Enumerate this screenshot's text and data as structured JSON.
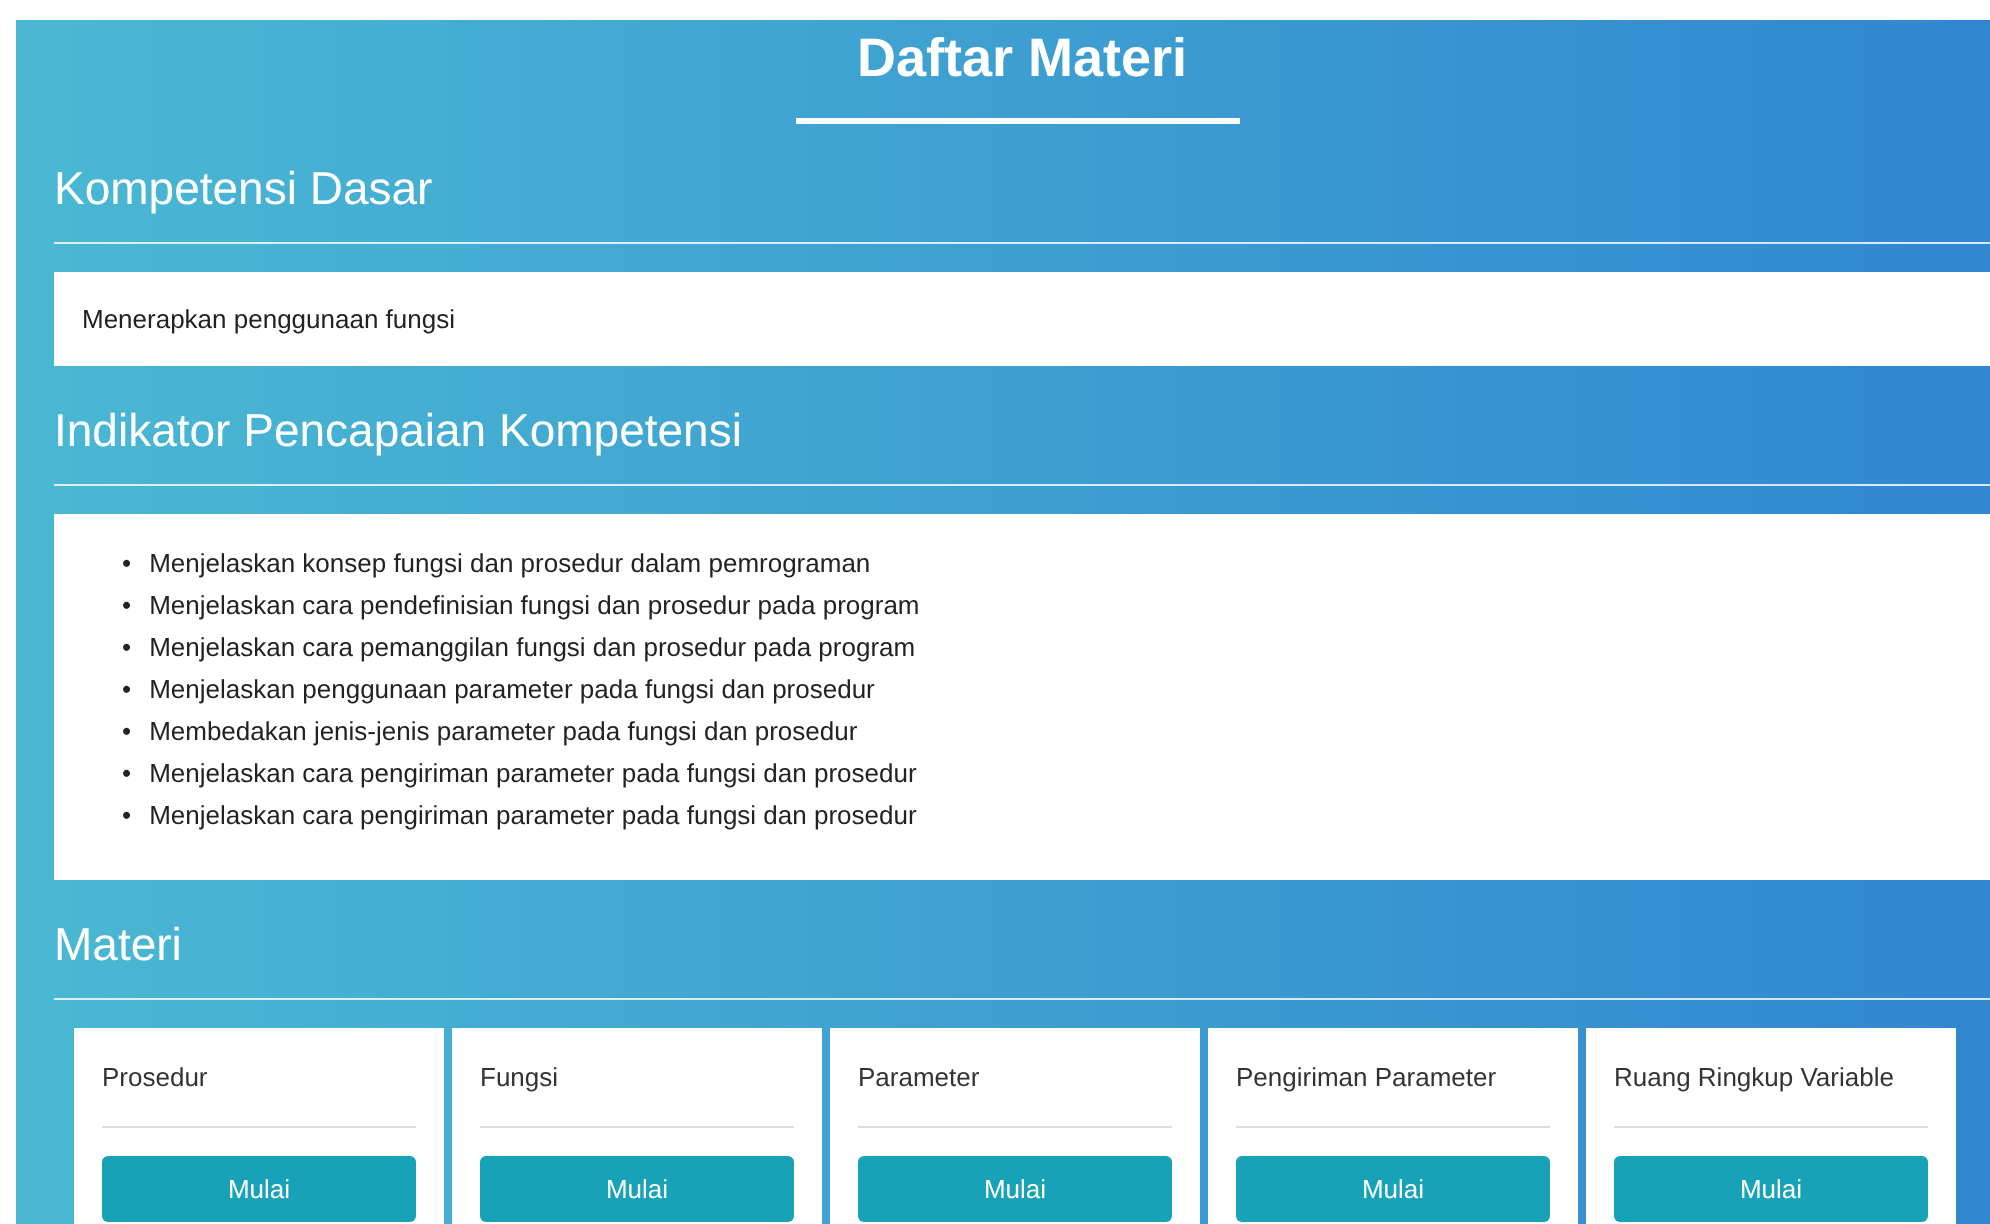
{
  "title": "Daftar Materi",
  "sections": [
    {
      "heading": "Kompetensi Dasar",
      "kind": "text",
      "text": "Menerapkan penggunaan fungsi"
    },
    {
      "heading": "Indikator Pencapaian Kompetensi",
      "kind": "list",
      "items": [
        {
          "bullet": "•",
          "text": "Menjelaskan konsep fungsi dan prosedur dalam pemrograman"
        },
        {
          "bullet": "•",
          "text": "Menjelaskan cara pendefinisian fungsi dan prosedur pada program"
        },
        {
          "bullet": "•",
          "text": "Menjelaskan cara pemanggilan fungsi dan prosedur pada program"
        },
        {
          "bullet": "•",
          "text": "Menjelaskan penggunaan parameter pada fungsi dan prosedur"
        },
        {
          "bullet": "•",
          "text": "Membedakan jenis-jenis parameter pada fungsi dan prosedur"
        },
        {
          "bullet": "•",
          "text": "Menjelaskan cara pengiriman parameter pada fungsi dan prosedur"
        },
        {
          "bullet": "•",
          "text": "Menjelaskan cara pengiriman parameter pada fungsi dan prosedur"
        }
      ]
    },
    {
      "heading": "Materi",
      "kind": "cards",
      "cards": [
        {
          "title": "Prosedur",
          "button": "Mulai"
        },
        {
          "title": "Fungsi",
          "button": "Mulai"
        },
        {
          "title": "Parameter",
          "button": "Mulai"
        },
        {
          "title": "Pengiriman Parameter",
          "button": "Mulai"
        },
        {
          "title": "Ruang Ringkup Variable",
          "button": "Mulai"
        }
      ]
    }
  ]
}
